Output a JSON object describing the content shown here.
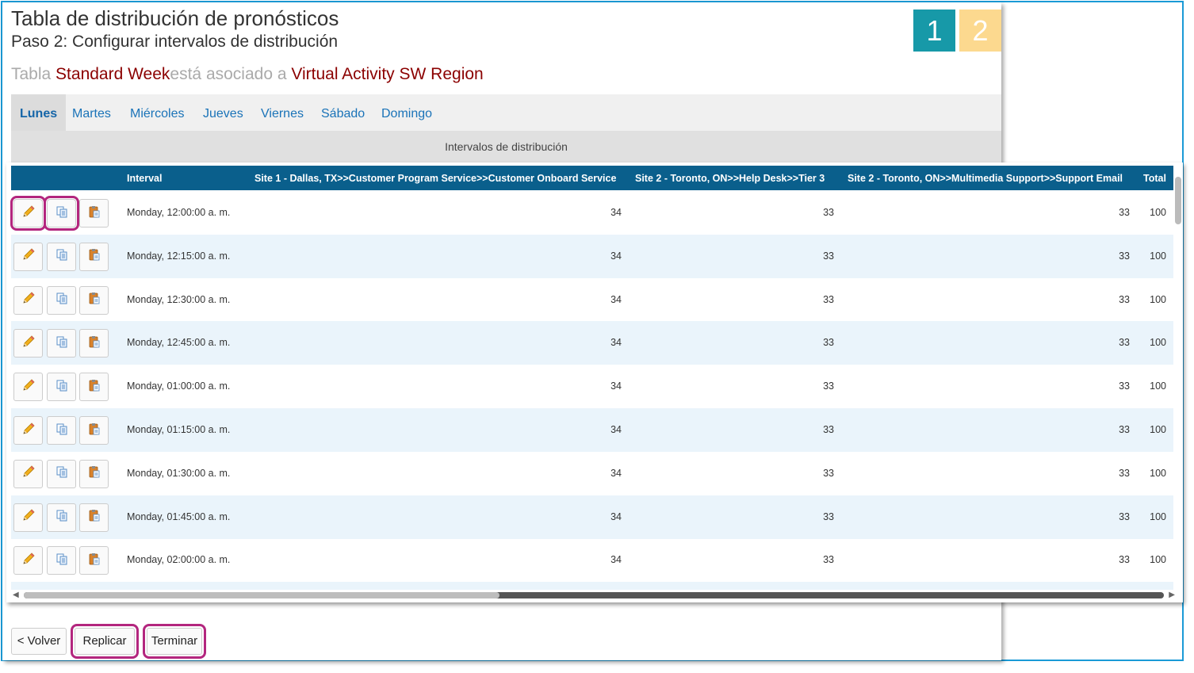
{
  "page": {
    "title": "Tabla de distribución de pronósticos",
    "subtitle": "Paso 2: Configurar intervalos de distribución",
    "assoc_prefix": "Tabla ",
    "table_name": "Standard Week",
    "assoc_middle": "está asociado a ",
    "activity_name": "Virtual Activity SW Region"
  },
  "steps": [
    "1",
    "2"
  ],
  "tabs": [
    "Lunes",
    "Martes",
    "Miércoles",
    "Jueves",
    "Viernes",
    "Sábado",
    "Domingo"
  ],
  "active_tab": "Lunes",
  "section_title": "Intervalos de distribución",
  "table": {
    "headers": {
      "interval": "Interval",
      "col1": "Site 1 - Dallas, TX>>Customer Program Service>>Customer Onboard Service",
      "col2": "Site 2 - Toronto, ON>>Help Desk>>Tier 3",
      "col3": "Site 2 - Toronto, ON>>Multimedia Support>>Support Email",
      "total": "Total"
    },
    "rows": [
      {
        "interval": "Monday, 12:00:00 a. m.",
        "col1": "34",
        "col2": "33",
        "col3": "33",
        "total": "100"
      },
      {
        "interval": "Monday, 12:15:00 a. m.",
        "col1": "34",
        "col2": "33",
        "col3": "33",
        "total": "100"
      },
      {
        "interval": "Monday, 12:30:00 a. m.",
        "col1": "34",
        "col2": "33",
        "col3": "33",
        "total": "100"
      },
      {
        "interval": "Monday, 12:45:00 a. m.",
        "col1": "34",
        "col2": "33",
        "col3": "33",
        "total": "100"
      },
      {
        "interval": "Monday, 01:00:00 a. m.",
        "col1": "34",
        "col2": "33",
        "col3": "33",
        "total": "100"
      },
      {
        "interval": "Monday, 01:15:00 a. m.",
        "col1": "34",
        "col2": "33",
        "col3": "33",
        "total": "100"
      },
      {
        "interval": "Monday, 01:30:00 a. m.",
        "col1": "34",
        "col2": "33",
        "col3": "33",
        "total": "100"
      },
      {
        "interval": "Monday, 01:45:00 a. m.",
        "col1": "34",
        "col2": "33",
        "col3": "33",
        "total": "100"
      },
      {
        "interval": "Monday, 02:00:00 a. m.",
        "col1": "34",
        "col2": "33",
        "col3": "33",
        "total": "100"
      }
    ],
    "row_buttons": [
      "pencil-icon",
      "copy-icon",
      "paste-icon"
    ]
  },
  "footer": {
    "back_label": "< Volver",
    "replicate_label": "Replicar",
    "finish_label": "Terminar"
  },
  "colors": {
    "header_bg": "#0a5f8c",
    "highlight_text": "#8b0000",
    "step1": "#1799a8",
    "step2": "#fcd98f",
    "callout": "#b3267e"
  }
}
